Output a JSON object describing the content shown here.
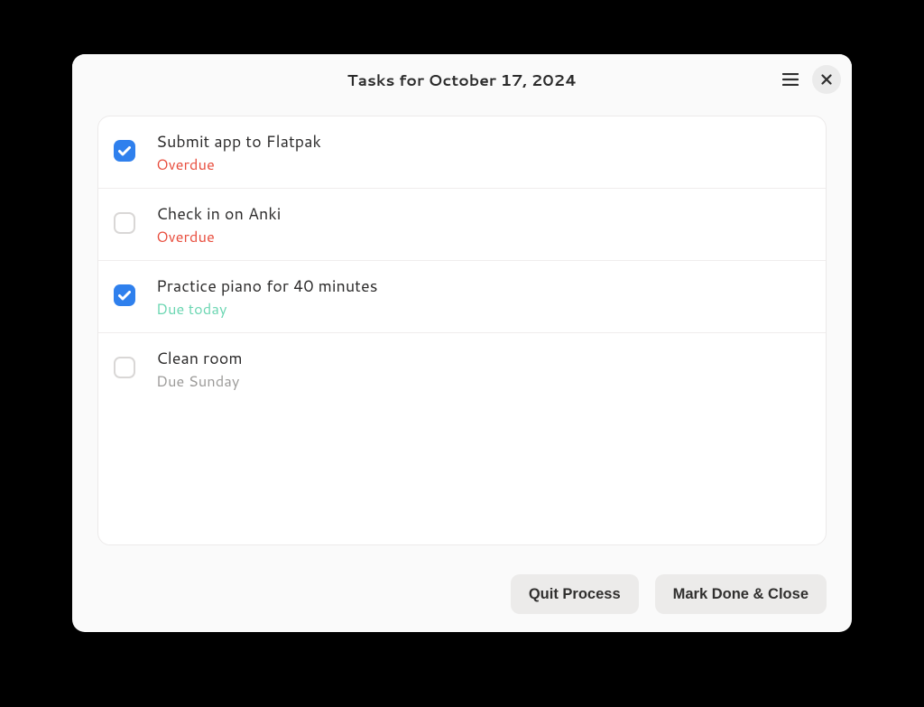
{
  "header": {
    "title": "Tasks for October 17, 2024"
  },
  "tasks": [
    {
      "title": "Submit app to Flatpak",
      "subtitle": "Overdue",
      "status": "overdue",
      "checked": true
    },
    {
      "title": "Check in on Anki",
      "subtitle": "Overdue",
      "status": "overdue",
      "checked": false
    },
    {
      "title": "Practice piano for 40 minutes",
      "subtitle": "Due today",
      "status": "today",
      "checked": true
    },
    {
      "title": "Clean room",
      "subtitle": "Due Sunday",
      "status": "future",
      "checked": false
    }
  ],
  "footer": {
    "quit_label": "Quit Process",
    "mark_done_label": "Mark Done & Close"
  }
}
